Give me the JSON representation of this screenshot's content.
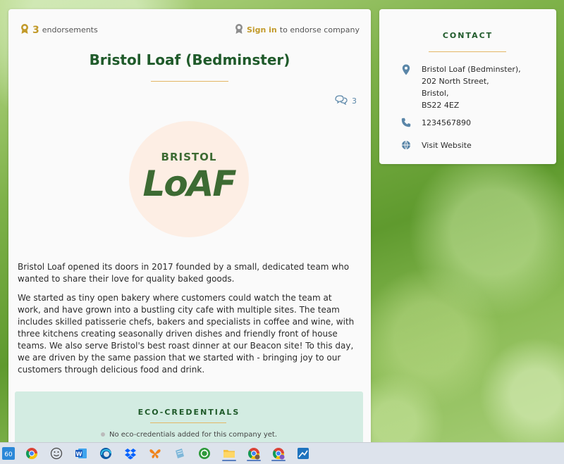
{
  "company": {
    "endorsement_count": "3",
    "endorsement_label": "endorsements",
    "signin_label": "Sign in",
    "signin_suffix": "to endorse company",
    "name": "Bristol Loaf (Bedminster)",
    "comment_count": "3",
    "logo": {
      "top_text": "BRISTOL",
      "main_text": "LoAF"
    },
    "description": [
      "Bristol Loaf opened its doors in 2017 founded by a small, dedicated team who wanted to share their love for quality baked goods.",
      "We started as tiny open bakery where customers could watch the team at work, and have grown into a bustling city cafe with multiple sites. The team includes skilled patisserie chefs, bakers and specialists in coffee and wine, with three kitchens creating seasonally driven dishes and friendly front of house teams. We also serve Bristol's best roast dinner at our Beacon site! To this day, we are driven by the same passion that we started with - bringing joy to our customers through delicious food and drink."
    ]
  },
  "eco": {
    "title": "ECO-CREDENTIALS",
    "empty_text": "No eco-credentials added for this company yet."
  },
  "contact": {
    "title": "CONTACT",
    "address_lines": [
      "Bristol Loaf (Bedminster),",
      "202 North Street,",
      "Bristol,",
      "BS22 4EZ"
    ],
    "phone": "1234567890",
    "website_label": "Visit Website"
  },
  "colors": {
    "brand_green": "#1f5a2a",
    "gold": "#c29a2a",
    "accent_blue": "#5a86a8",
    "eco_bg": "#d3ece2"
  },
  "taskbar": {
    "icons": [
      "widgets-icon",
      "chrome-icon",
      "emoji-icon",
      "word-icon",
      "edge-icon",
      "dropbox-icon",
      "butterfly-icon",
      "notepad-icon",
      "recycle-icon",
      "file-explorer-icon",
      "chrome-profile-icon",
      "chrome-profile-s-icon",
      "blue-app-icon"
    ]
  }
}
